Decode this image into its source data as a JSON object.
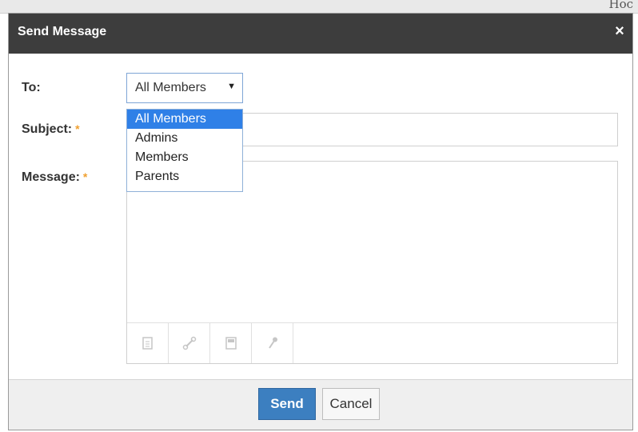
{
  "backdrop": {
    "text": "Hoc"
  },
  "dialog": {
    "title": "Send Message",
    "close_glyph": "×"
  },
  "form": {
    "to_label": "To:",
    "to_value": "All Members",
    "subject_label": "Subject:",
    "message_label": "Message:",
    "required_marker": "*",
    "subject_value": "",
    "message_value": ""
  },
  "dropdown": {
    "options": [
      "All Members",
      "Admins",
      "Members",
      "Parents"
    ],
    "selected_index": 0
  },
  "toolbar": {
    "icons": [
      "attachment-icon",
      "link-icon",
      "document-icon",
      "microphone-icon"
    ]
  },
  "footer": {
    "send_label": "Send",
    "cancel_label": "Cancel"
  },
  "colors": {
    "titlebar": "#3d3d3d",
    "accent": "#2f80e7",
    "send_button": "#3c7fc0",
    "required": "#f0a030"
  }
}
